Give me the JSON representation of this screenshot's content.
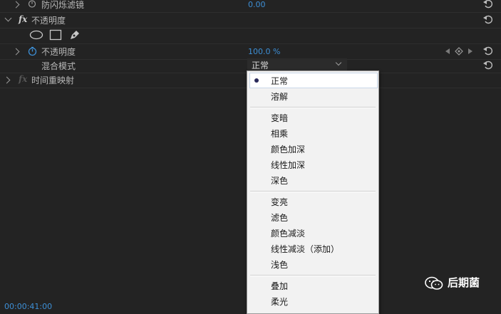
{
  "rows": {
    "anti_flicker": {
      "label": "防闪烁滤镜",
      "value": "0.00"
    },
    "opacity_group": {
      "label": "不透明度"
    },
    "opacity": {
      "label": "不透明度",
      "value": "100.0 %"
    },
    "blend_mode": {
      "label": "混合模式",
      "value": "正常"
    },
    "time_remap": {
      "label": "时间重映射"
    }
  },
  "fx_badge": "fx",
  "blend_menu": {
    "groups": [
      [
        "正常",
        "溶解"
      ],
      [
        "变暗",
        "相乘",
        "颜色加深",
        "线性加深",
        "深色"
      ],
      [
        "变亮",
        "滤色",
        "颜色减淡",
        "线性减淡（添加）",
        "浅色"
      ],
      [
        "叠加",
        "柔光"
      ]
    ],
    "selected": "正常"
  },
  "bottom_timecode": "00:00:41:00",
  "watermark": "后期菌",
  "colors": {
    "value_blue": "#3d8fd6",
    "panel_bg": "#232323",
    "menu_bg": "#f2f2f2"
  }
}
